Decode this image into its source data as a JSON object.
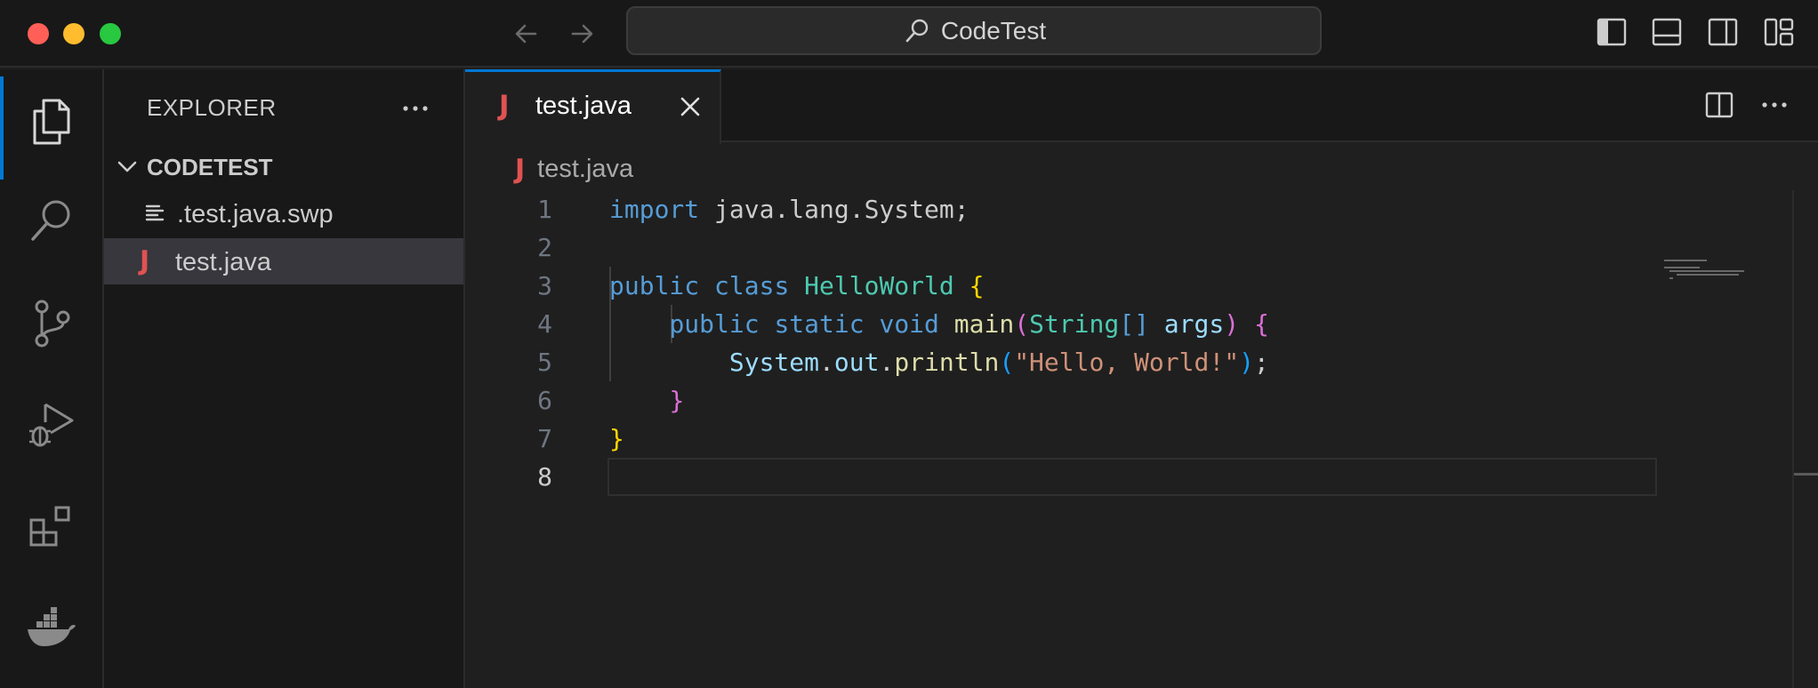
{
  "window": {
    "search_text": "CodeTest"
  },
  "sidebar": {
    "title": "EXPLORER",
    "folder": "CODETEST",
    "files": [
      {
        "name": ".test.java.swp",
        "icon": "lines-file-icon"
      },
      {
        "name": "test.java",
        "icon": "java-file-icon",
        "icon_glyph": "J"
      }
    ]
  },
  "editor": {
    "tab_label": "test.java",
    "tab_icon_glyph": "J",
    "breadcrumb": "test.java",
    "line_numbers": [
      "1",
      "2",
      "3",
      "4",
      "5",
      "6",
      "7",
      "8"
    ],
    "current_line": "8",
    "code": {
      "l1_import": "import",
      "l1_rest": " java.lang.System;",
      "l3_public": "public",
      "l3_class": "class",
      "l3_name": "HelloWorld",
      "brace_open": "{",
      "brace_close": "}",
      "l4_public": "public",
      "l4_static": "static",
      "l4_void": "void",
      "l4_main": "main",
      "paren_open": "(",
      "paren_close": ")",
      "l4_string_type": "String",
      "l4_brackets": "[]",
      "l4_args": "args",
      "l5_system": "System",
      "dot": ".",
      "l5_out": "out",
      "l5_println": "println",
      "l5_string": "\"Hello, World!\"",
      "semicolon": ";"
    }
  },
  "colors": {
    "accent": "#0078d4",
    "java_icon": "#e05252",
    "keyword": "#569cd6",
    "type": "#4ec9b0",
    "function": "#dcdcaa",
    "variable": "#9cdcfe",
    "string": "#ce9178"
  }
}
